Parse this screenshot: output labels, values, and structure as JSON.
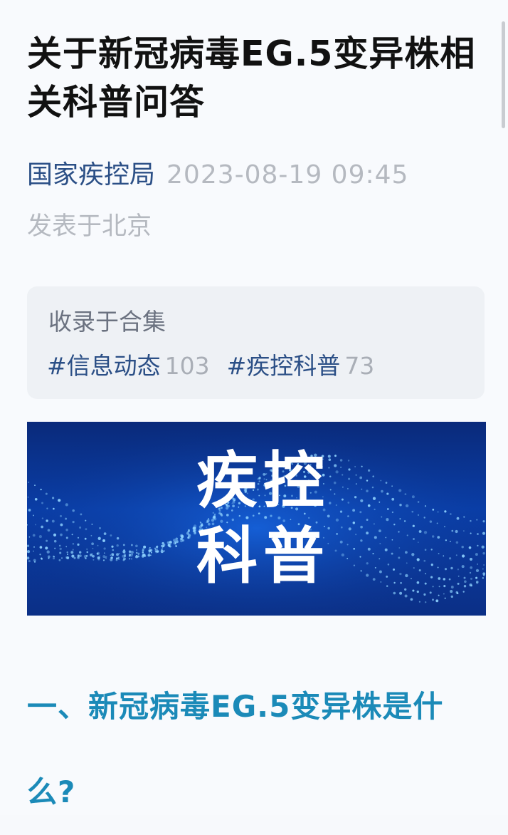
{
  "article": {
    "title": "关于新冠病毒EG.5变异株相关科普问答",
    "author": "国家疾控局",
    "datetime": "2023-08-19 09:45",
    "location": "发表于北京"
  },
  "collection": {
    "label": "收录于合集",
    "tags": [
      {
        "name": "#信息动态",
        "count": "103"
      },
      {
        "name": "#疾控科普",
        "count": "73"
      }
    ]
  },
  "banner": {
    "line1": "疾控",
    "line2": "科普"
  },
  "section": {
    "heading": "一、新冠病毒EG.5变异株是什么?"
  },
  "colors": {
    "title": "#111111",
    "author": "#2b4f86",
    "muted": "#b5b9c0",
    "heading": "#1b8ab8",
    "banner_bg": "#0a3ea8"
  }
}
